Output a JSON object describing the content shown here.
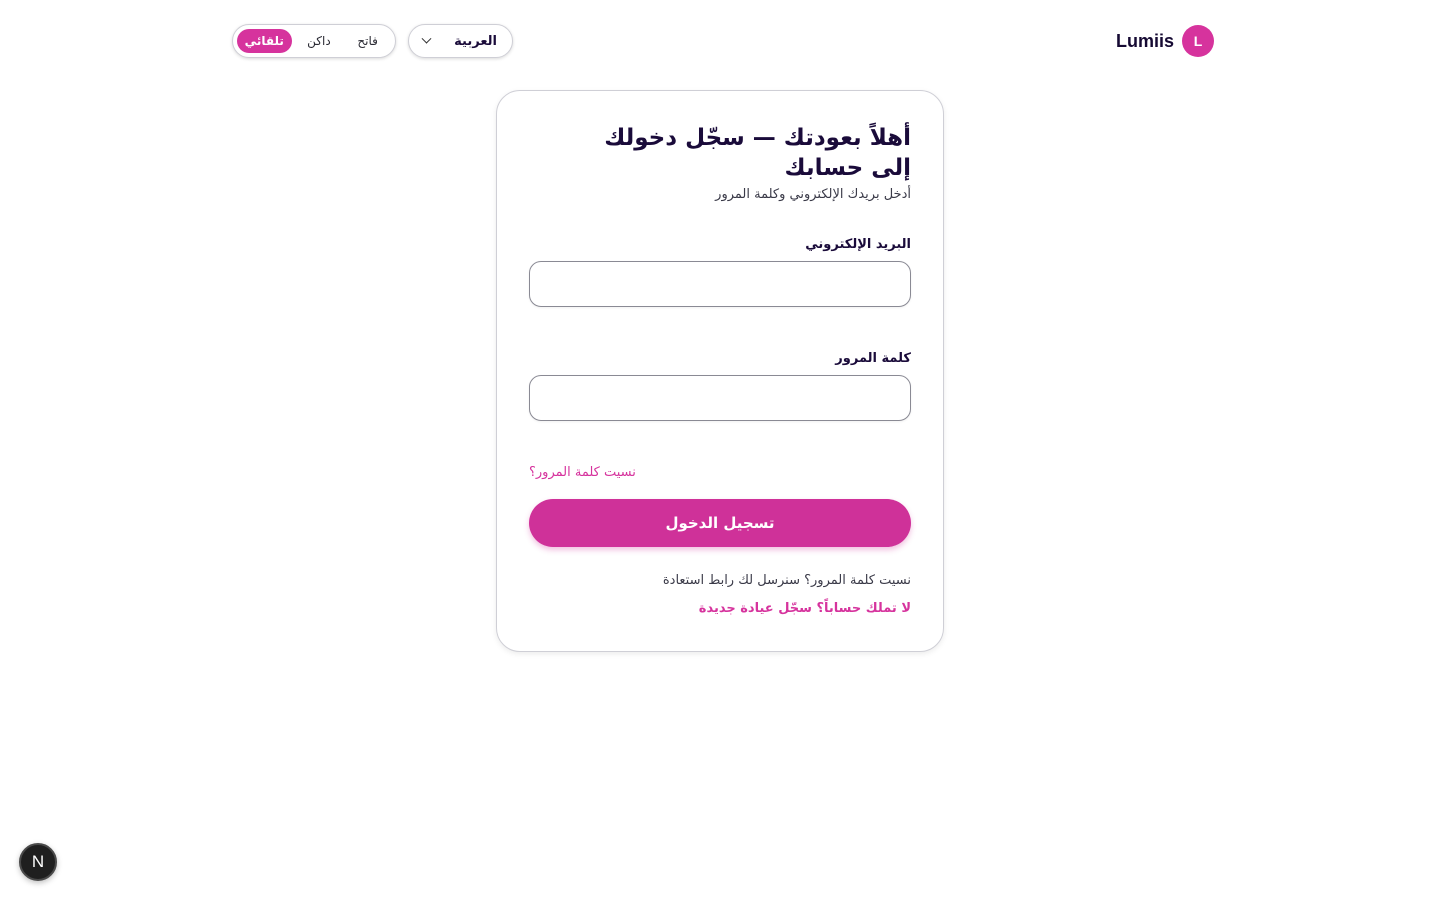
{
  "header": {
    "brand_initial": "L",
    "brand_name": "Lumiis",
    "language": {
      "selected": "العربية"
    },
    "theme": {
      "light": "فاتح",
      "dark": "داكن",
      "auto": "تلقائي",
      "selected": "auto"
    }
  },
  "login": {
    "title": "أهلاً بعودتك — سجّل دخولك إلى حسابك",
    "subtitle": "أدخل بريدك الإلكتروني وكلمة المرور",
    "email_label": "البريد الإلكتروني",
    "email_value": "",
    "password_label": "كلمة المرور",
    "password_value": "",
    "forgot_link": "نسيت كلمة المرور؟",
    "submit_label": "تسجيل الدخول",
    "hint": "نسيت كلمة المرور؟ سنرسل لك رابط استعادة",
    "signup_link": "لا تملك حساباً؟ سجّل عيادة جديدة"
  },
  "dev_badge": {
    "label": "N"
  },
  "colors": {
    "accent": "#d6339d",
    "text": "#1a0b3a"
  }
}
